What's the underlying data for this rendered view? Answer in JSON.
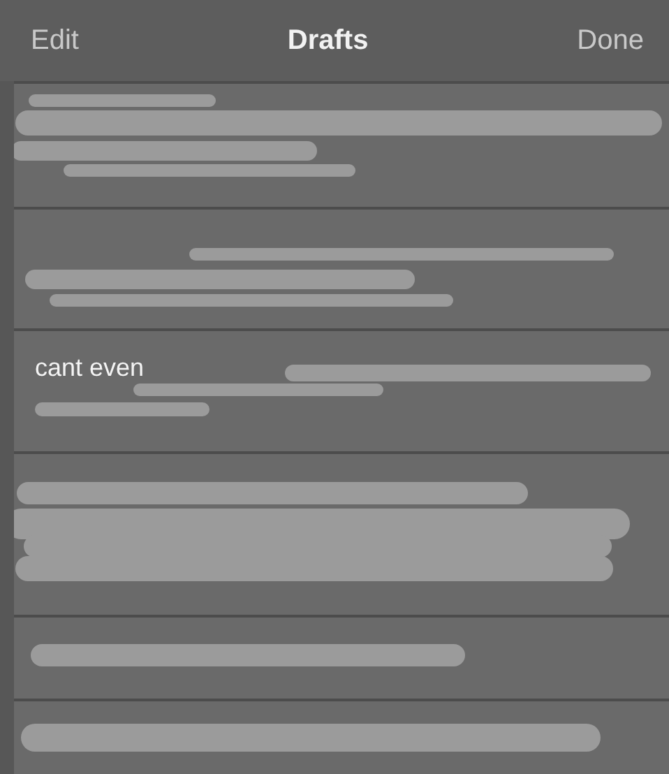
{
  "nav_bar": {
    "left_button": "Edit",
    "title": "Drafts",
    "right_button": "Done"
  },
  "drafts": [
    {
      "kind": "redacted"
    },
    {
      "kind": "redacted"
    },
    {
      "kind": "partial",
      "visible_text": "cant even"
    },
    {
      "kind": "redacted"
    },
    {
      "kind": "redacted"
    },
    {
      "kind": "redacted"
    }
  ]
}
